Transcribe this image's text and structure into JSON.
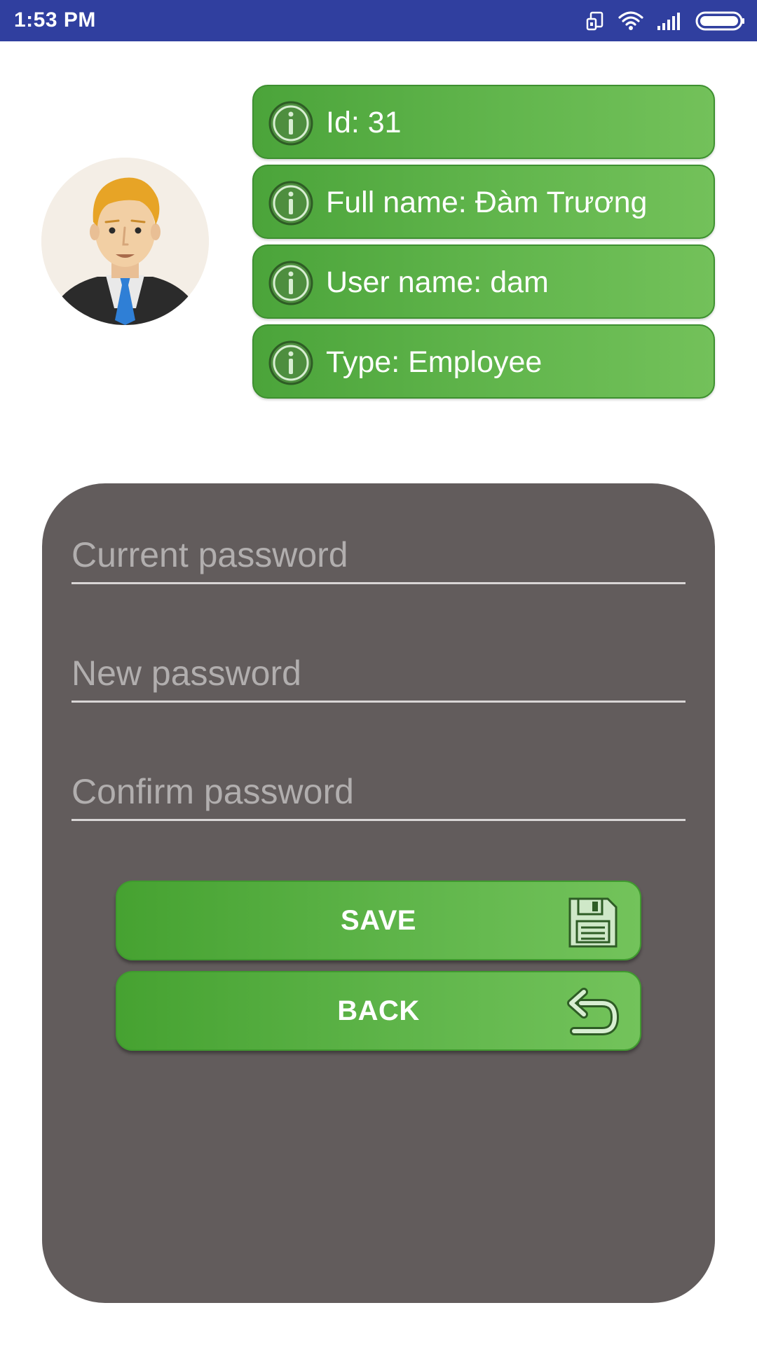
{
  "status_bar": {
    "time": "1:53 PM",
    "icons": [
      "rotate-screen-icon",
      "wifi-icon",
      "signal-icon",
      "battery-icon"
    ]
  },
  "profile": {
    "avatar": "businessman-avatar",
    "info": [
      {
        "icon": "info-icon",
        "text": "Id: 31"
      },
      {
        "icon": "info-icon",
        "text": "Full name: Đàm Trương"
      },
      {
        "icon": "info-icon",
        "text": "User name: dam"
      },
      {
        "icon": "info-icon",
        "text": "Type: Employee"
      }
    ]
  },
  "password_form": {
    "current_placeholder": "Current password",
    "new_placeholder": "New password",
    "confirm_placeholder": "Confirm password",
    "current_value": "",
    "new_value": "",
    "confirm_value": ""
  },
  "buttons": {
    "save_label": "SAVE",
    "save_icon": "floppy-disk-icon",
    "back_label": "BACK",
    "back_icon": "undo-arrow-icon"
  },
  "colors": {
    "status_bar": "#303f9f",
    "accent_green": "#5fb54a",
    "card_background": "#625c5c"
  }
}
